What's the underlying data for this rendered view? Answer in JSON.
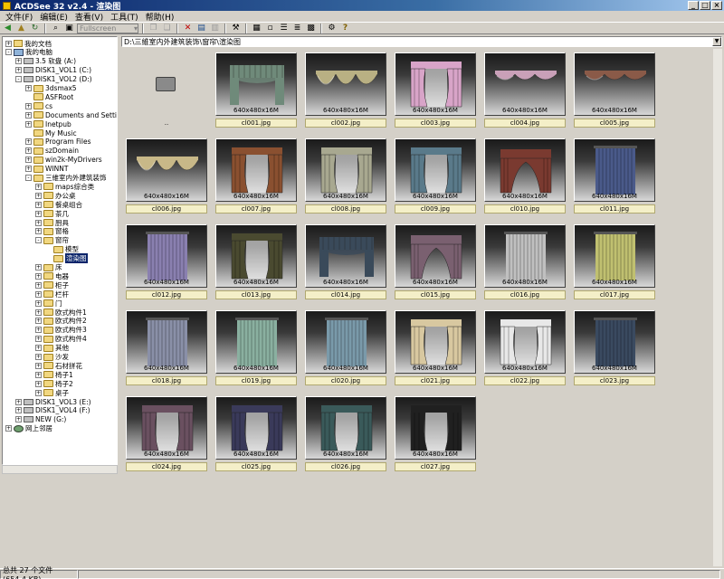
{
  "window": {
    "title": "ACDSee 32 v2.4 - 渲染图",
    "buttons": [
      "_",
      "□",
      "×"
    ]
  },
  "menu": [
    "文件(F)",
    "编辑(E)",
    "查看(V)",
    "工具(T)",
    "帮助(H)"
  ],
  "toolbar": {
    "combo_label": "Fullscreen"
  },
  "tree": [
    {
      "label": "我的文档",
      "depth": 0,
      "icon": "doc-icon",
      "expander": "+"
    },
    {
      "label": "我的电脑",
      "depth": 0,
      "icon": "pc-icon",
      "expander": "-"
    },
    {
      "label": "3.5 软盘 (A:)",
      "depth": 1,
      "icon": "drive-icon",
      "expander": "+"
    },
    {
      "label": "DISK1_VOL1 (C:)",
      "depth": 1,
      "icon": "drive-icon",
      "expander": "+"
    },
    {
      "label": "DISK1_VOL2 (D:)",
      "depth": 1,
      "icon": "drive-icon",
      "expander": "-"
    },
    {
      "label": "3dsmax5",
      "depth": 2,
      "icon": "folder-icon",
      "expander": "+"
    },
    {
      "label": "ASFRoot",
      "depth": 2,
      "icon": "folder-icon",
      "expander": ""
    },
    {
      "label": "cs",
      "depth": 2,
      "icon": "folder-icon",
      "expander": "+"
    },
    {
      "label": "Documents and Settings",
      "depth": 2,
      "icon": "folder-icon",
      "expander": "+"
    },
    {
      "label": "Inetpub",
      "depth": 2,
      "icon": "folder-icon",
      "expander": "+"
    },
    {
      "label": "My Music",
      "depth": 2,
      "icon": "folder-icon",
      "expander": ""
    },
    {
      "label": "Program Files",
      "depth": 2,
      "icon": "folder-icon",
      "expander": "+"
    },
    {
      "label": "szDomain",
      "depth": 2,
      "icon": "folder-icon",
      "expander": "+"
    },
    {
      "label": "win2k-MyDrivers",
      "depth": 2,
      "icon": "folder-icon",
      "expander": "+"
    },
    {
      "label": "WINNT",
      "depth": 2,
      "icon": "folder-icon",
      "expander": "+"
    },
    {
      "label": "三維室内外建筑装饰",
      "depth": 2,
      "icon": "folder-icon",
      "expander": "-"
    },
    {
      "label": "maps综合类",
      "depth": 3,
      "icon": "folder-icon",
      "expander": "+"
    },
    {
      "label": "办公桌",
      "depth": 3,
      "icon": "folder-icon",
      "expander": "+"
    },
    {
      "label": "餐桌组合",
      "depth": 3,
      "icon": "folder-icon",
      "expander": "+"
    },
    {
      "label": "茶几",
      "depth": 3,
      "icon": "folder-icon",
      "expander": "+"
    },
    {
      "label": "厨具",
      "depth": 3,
      "icon": "folder-icon",
      "expander": "+"
    },
    {
      "label": "窗格",
      "depth": 3,
      "icon": "folder-icon",
      "expander": "+"
    },
    {
      "label": "窗帘",
      "depth": 3,
      "icon": "folder-icon",
      "expander": "-"
    },
    {
      "label": "模型",
      "depth": 4,
      "icon": "folder-icon",
      "expander": ""
    },
    {
      "label": "渲染图",
      "depth": 4,
      "icon": "folder-icon",
      "expander": "",
      "selected": true
    },
    {
      "label": "床",
      "depth": 3,
      "icon": "folder-icon",
      "expander": "+"
    },
    {
      "label": "电器",
      "depth": 3,
      "icon": "folder-icon",
      "expander": "+"
    },
    {
      "label": "柜子",
      "depth": 3,
      "icon": "folder-icon",
      "expander": "+"
    },
    {
      "label": "栏杆",
      "depth": 3,
      "icon": "folder-icon",
      "expander": "+"
    },
    {
      "label": "门",
      "depth": 3,
      "icon": "folder-icon",
      "expander": "+"
    },
    {
      "label": "欧式构件1",
      "depth": 3,
      "icon": "folder-icon",
      "expander": "+"
    },
    {
      "label": "欧式构件2",
      "depth": 3,
      "icon": "folder-icon",
      "expander": "+"
    },
    {
      "label": "欧式构件3",
      "depth": 3,
      "icon": "folder-icon",
      "expander": "+"
    },
    {
      "label": "欧式构件4",
      "depth": 3,
      "icon": "folder-icon",
      "expander": "+"
    },
    {
      "label": "其他",
      "depth": 3,
      "icon": "folder-icon",
      "expander": "+"
    },
    {
      "label": "沙发",
      "depth": 3,
      "icon": "folder-icon",
      "expander": "+"
    },
    {
      "label": "石材拼花",
      "depth": 3,
      "icon": "folder-icon",
      "expander": "+"
    },
    {
      "label": "椅子1",
      "depth": 3,
      "icon": "folder-icon",
      "expander": "+"
    },
    {
      "label": "椅子2",
      "depth": 3,
      "icon": "folder-icon",
      "expander": "+"
    },
    {
      "label": "桌子",
      "depth": 3,
      "icon": "folder-icon",
      "expander": "+"
    },
    {
      "label": "DISK1_VOL3 (E:)",
      "depth": 1,
      "icon": "drive-icon",
      "expander": "+"
    },
    {
      "label": "DISK1_VOL4 (F:)",
      "depth": 1,
      "icon": "drive-icon",
      "expander": "+"
    },
    {
      "label": "NEW (G:)",
      "depth": 1,
      "icon": "drive-icon",
      "expander": "+"
    },
    {
      "label": "网上邻居",
      "depth": 0,
      "icon": "net-icon",
      "expander": "+"
    }
  ],
  "path": "D:\\三維室内外建筑装饰\\窗帘\\渲染图",
  "parent_label": "..",
  "size_label": "640x480x16M",
  "thumbnails": [
    {
      "name": "cl001.jpg",
      "color": "#6f8a7a",
      "style": "valance"
    },
    {
      "name": "cl002.jpg",
      "color": "#b9b083",
      "style": "swag"
    },
    {
      "name": "cl003.jpg",
      "color": "#d8a4c8",
      "style": "drape"
    },
    {
      "name": "cl004.jpg",
      "color": "#c9a0b8",
      "style": "swagthin"
    },
    {
      "name": "cl005.jpg",
      "color": "#8a5a48",
      "style": "swagthin"
    },
    {
      "name": "cl006.jpg",
      "color": "#c8b888",
      "style": "swag"
    },
    {
      "name": "cl007.jpg",
      "color": "#8a5030",
      "style": "drape"
    },
    {
      "name": "cl008.jpg",
      "color": "#a8a890",
      "style": "drape"
    },
    {
      "name": "cl009.jpg",
      "color": "#5a7a8a",
      "style": "drape"
    },
    {
      "name": "cl010.jpg",
      "color": "#7a3a30",
      "style": "arch"
    },
    {
      "name": "cl011.jpg",
      "color": "#4a5a8a",
      "style": "panel"
    },
    {
      "name": "cl012.jpg",
      "color": "#8a80b0",
      "style": "panel"
    },
    {
      "name": "cl013.jpg",
      "color": "#4a4a30",
      "style": "drape"
    },
    {
      "name": "cl014.jpg",
      "color": "#3a4a5a",
      "style": "valance"
    },
    {
      "name": "cl015.jpg",
      "color": "#7a6070",
      "style": "arch"
    },
    {
      "name": "cl016.jpg",
      "color": "#c0c0c0",
      "style": "panel"
    },
    {
      "name": "cl017.jpg",
      "color": "#c0c070",
      "style": "panel"
    },
    {
      "name": "cl018.jpg",
      "color": "#8a90a8",
      "style": "panel"
    },
    {
      "name": "cl019.jpg",
      "color": "#8ab0a0",
      "style": "panel"
    },
    {
      "name": "cl020.jpg",
      "color": "#7a9aaa",
      "style": "panel"
    },
    {
      "name": "cl021.jpg",
      "color": "#d8c8a0",
      "style": "drape"
    },
    {
      "name": "cl022.jpg",
      "color": "#e8e8e8",
      "style": "drape"
    },
    {
      "name": "cl023.jpg",
      "color": "#3a4a60",
      "style": "panel"
    },
    {
      "name": "cl024.jpg",
      "color": "#6a5060",
      "style": "drape"
    },
    {
      "name": "cl025.jpg",
      "color": "#3a3a5a",
      "style": "drape"
    },
    {
      "name": "cl026.jpg",
      "color": "#3a5a5a",
      "style": "drape"
    },
    {
      "name": "cl027.jpg",
      "color": "#202020",
      "style": "drape"
    }
  ],
  "status": {
    "summary": "总共 27 个文件 (654.4 KB)"
  }
}
